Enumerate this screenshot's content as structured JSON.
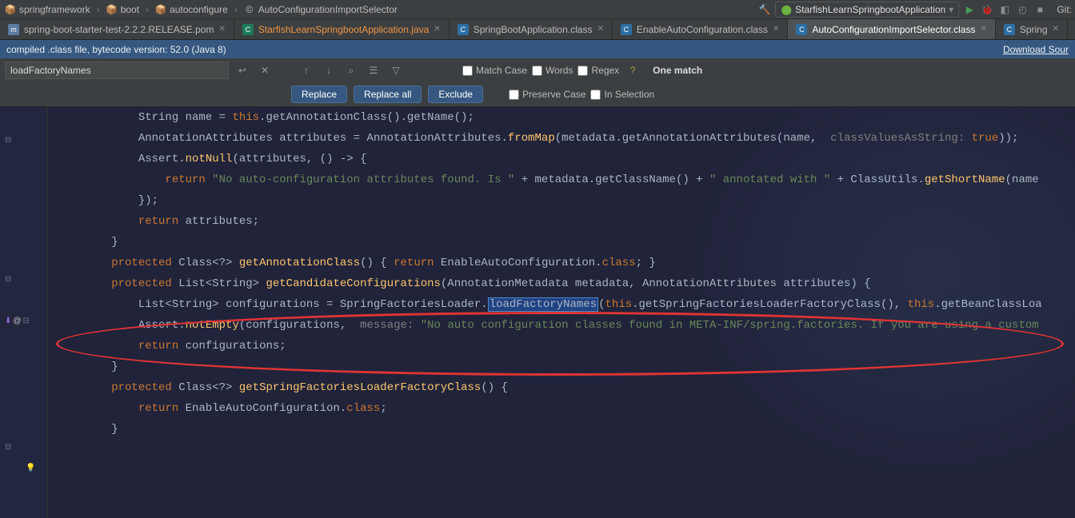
{
  "breadcrumb": {
    "segs": [
      "springframework",
      "boot",
      "autoconfigure",
      "AutoConfigurationImportSelector"
    ],
    "run_config": "StarfishLearnSpringbootApplication",
    "git_label": "Git:"
  },
  "tabs": [
    {
      "name": "spring-boot-starter-test-2.2.2.RELEASE.pom",
      "icon": "xml",
      "highlight": false
    },
    {
      "name": "StarfishLearnSpringbootApplication.java",
      "icon": "java-app",
      "highlight": true
    },
    {
      "name": "SpringBootApplication.class",
      "icon": "java-cls",
      "highlight": false
    },
    {
      "name": "EnableAutoConfiguration.class",
      "icon": "java-cls",
      "highlight": false
    },
    {
      "name": "AutoConfigurationImportSelector.class",
      "icon": "java-cls",
      "highlight": false,
      "active": true
    },
    {
      "name": "Spring",
      "icon": "java-cls",
      "highlight": false
    }
  ],
  "notice": {
    "text": "compiled .class file, bytecode version: 52.0 (Java 8)",
    "link": "Download Sour"
  },
  "find": {
    "value": "loadFactoryNames",
    "matchcase": "Match Case",
    "words": "Words",
    "regex": "Regex",
    "match_count": "One match",
    "preserve": "Preserve Case",
    "inselection": "In Selection",
    "replace_btn": "Replace",
    "replaceall_btn": "Replace all",
    "exclude_btn": "Exclude"
  },
  "code_lines": [
    {
      "indent": 3,
      "html": "String name = <span class='kw'>this</span>.getAnnotationClass().getName();"
    },
    {
      "indent": 3,
      "html": "AnnotationAttributes attributes = AnnotationAttributes.<span class='method'>fromMap</span>(metadata.getAnnotationAttributes(name,  <span class='comment-hint'>classValuesAsString:</span> <span class='kw'>true</span>));"
    },
    {
      "indent": 3,
      "html": "Assert.<span class='method'>notNull</span>(attributes, () -> {"
    },
    {
      "indent": 4,
      "html": "<span class='kw'>return</span> <span class='str'>\"No auto-configuration attributes found. Is \"</span> + metadata.getClassName() + <span class='str'>\" annotated with \"</span> + ClassUtils.<span class='method'>getShortName</span>(name"
    },
    {
      "indent": 3,
      "html": "});"
    },
    {
      "indent": 3,
      "html": "<span class='kw'>return</span> attributes;"
    },
    {
      "indent": 2,
      "html": "}"
    },
    {
      "indent": 0,
      "html": ""
    },
    {
      "indent": 2,
      "html": "<span class='kw'>protected</span> Class&lt;?&gt; <span class='method'>getAnnotationClass</span>() { <span class='kw'>return</span> EnableAutoConfiguration.<span class='kw'>class</span>; }"
    },
    {
      "indent": 0,
      "html": ""
    },
    {
      "indent": 2,
      "html": "<span class='kw'>protected</span> List&lt;String&gt; <span class='method'>getCandidateConfigurations</span>(AnnotationMetadata metadata, AnnotationAttributes attributes) {"
    },
    {
      "indent": 3,
      "html": "List&lt;String&gt; configurations = SpringFactoriesLoader.<span class='search-hit'>loadFactoryNames</span>(<span class='kw'>this</span>.getSpringFactoriesLoaderFactoryClass(), <span class='kw'>this</span>.getBeanClassLoa"
    },
    {
      "indent": 3,
      "html": "Assert.<span class='method'>notEmpty</span>(configurations,  <span class='comment-hint'>message:</span> <span class='str'>\"No auto configuration classes found in META-INF/spring.factories. If you are using a custom </span>"
    },
    {
      "indent": 3,
      "html": "<span class='kw'>return</span> configurations;"
    },
    {
      "indent": 2,
      "html": "}"
    },
    {
      "indent": 0,
      "html": ""
    },
    {
      "indent": 2,
      "html": "<span class='kw'>protected</span> Class&lt;?&gt; <span class='method'>getSpringFactoriesLoaderFactoryClass</span>() {"
    },
    {
      "indent": 3,
      "html": "<span class='kw'>return</span> EnableAutoConfiguration.<span class='kw'>class</span>;"
    },
    {
      "indent": 2,
      "html": "}"
    }
  ]
}
